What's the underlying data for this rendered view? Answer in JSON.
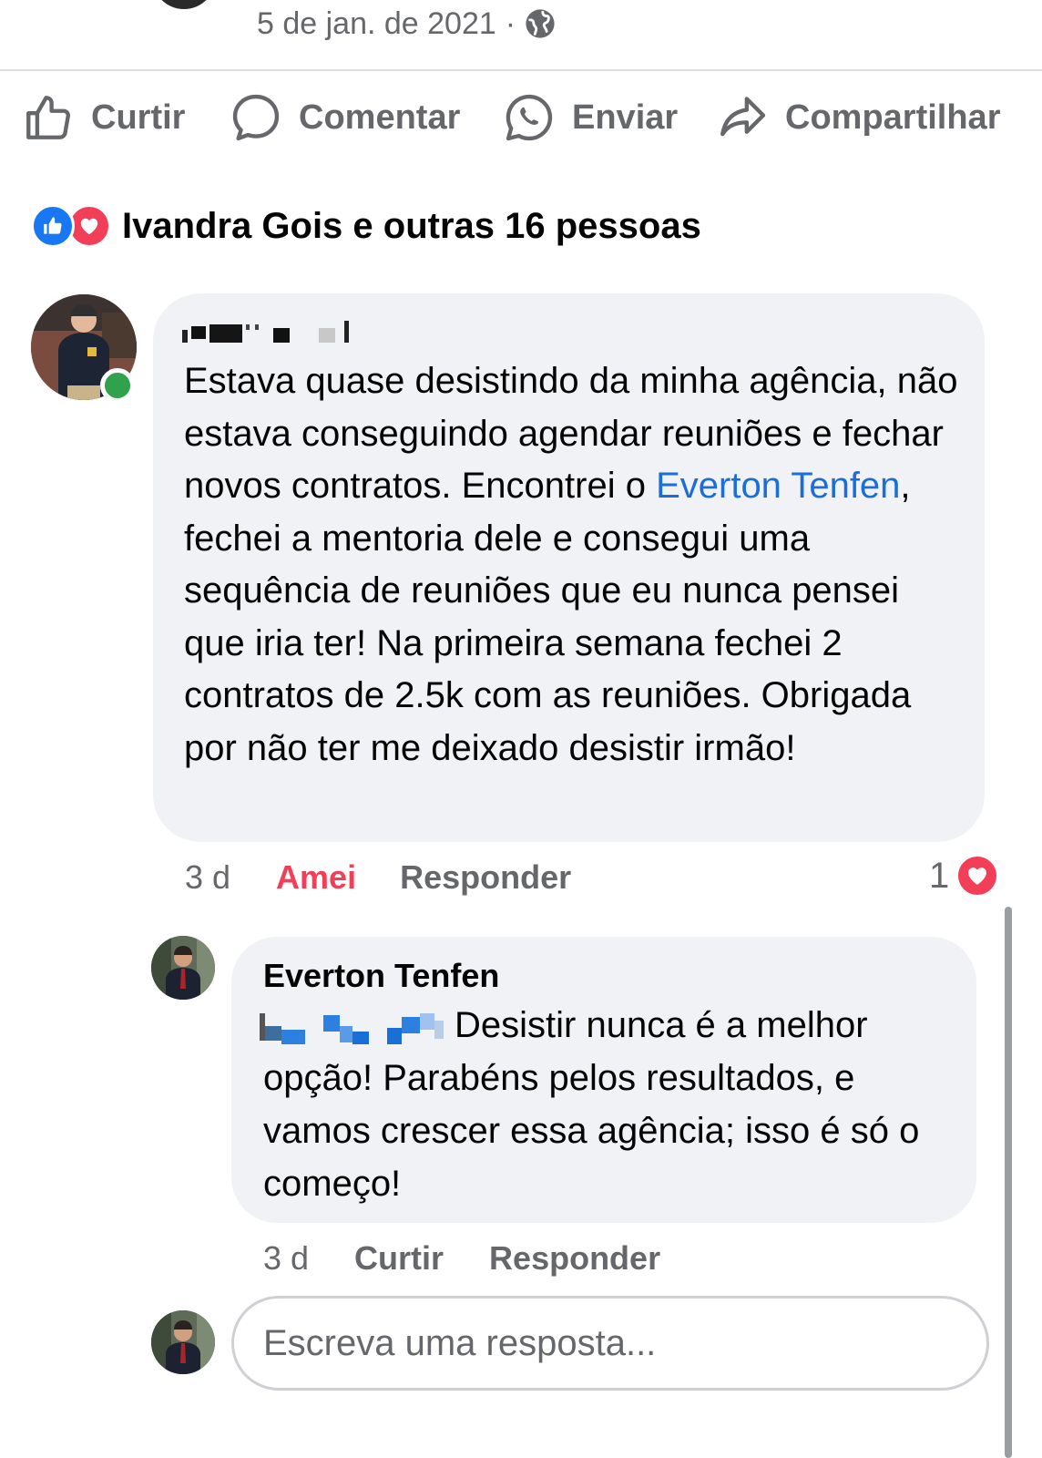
{
  "post": {
    "date": "5 de jan. de 2021",
    "separator": "·",
    "privacy_icon": "globe-icon"
  },
  "actions": {
    "like": {
      "label": "Curtir",
      "icon": "thumbs-up-icon"
    },
    "comment": {
      "label": "Comentar",
      "icon": "comment-bubble-icon"
    },
    "send": {
      "label": "Enviar",
      "icon": "whatsapp-icon"
    },
    "share": {
      "label": "Compartilhar",
      "icon": "share-arrow-icon"
    }
  },
  "reactions": {
    "summary": "Ivandra Gois e outras 16 pessoas",
    "icons": [
      "like-reaction-icon",
      "love-reaction-icon"
    ]
  },
  "comment": {
    "author_redacted": true,
    "online": true,
    "text_before_mention": "Estava quase desistindo da minha agência, não estava conseguindo agendar reuniões e fechar novos contratos. Encontrei o ",
    "mention": "Everton Tenfen",
    "text_after_mention": ", fechei a mentoria dele e consegui uma sequência de reuniões que eu nunca pensei que iria ter! Na primeira semana fechei 2 contratos de 2.5k com as reuniões. Obrigada por não ter me deixado desistir irmão!",
    "time": "3 d",
    "reaction_label": "Amei",
    "reply_label": "Responder",
    "reaction_count": "1"
  },
  "reply": {
    "author": "Everton Tenfen",
    "mention_redacted": true,
    "text": "Desistir nunca é a melhor opção! Parabéns pelos resultados, e vamos crescer essa agência; isso é só o começo!",
    "time": "3 d",
    "like_label": "Curtir",
    "reply_label": "Responder"
  },
  "reply_box": {
    "placeholder": "Escreva uma resposta..."
  },
  "colors": {
    "bubble": "#f0f2f5",
    "secondary_text": "#65676b",
    "link": "#1a6ed8",
    "love": "#f33e58",
    "like": "#1877f2",
    "online": "#31a24c"
  }
}
